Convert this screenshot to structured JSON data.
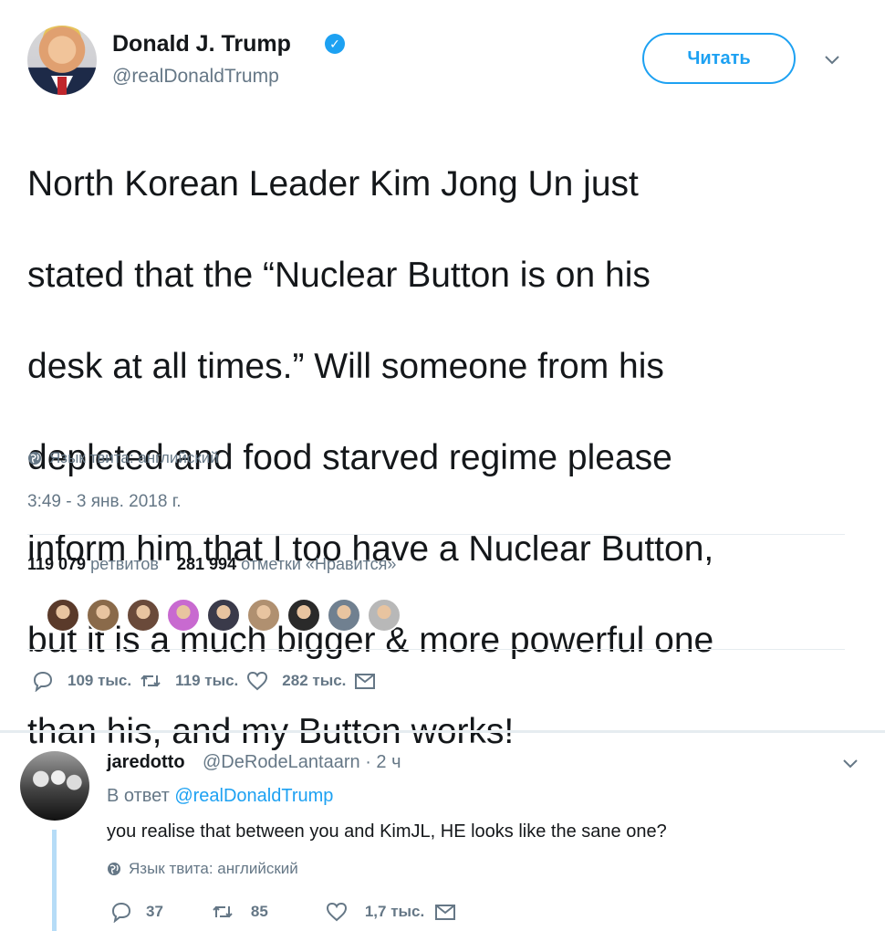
{
  "tweet": {
    "author_name": "Donald J. Trump",
    "verified_glyph": "✓",
    "handle": "@realDonaldTrump",
    "follow_label": "Читать",
    "text_lines": [
      "North Korean Leader Kim Jong Un just",
      "stated that the “Nuclear Button is on his",
      "desk at all times.” Will someone from his",
      "depleted and food starved regime please",
      "inform him that I too have a Nuclear Button,",
      "but it is a much bigger & more powerful one",
      "than his, and my Button works!"
    ],
    "language_note": "Язык твита: английский",
    "timestamp": "3:49 - 3 янв. 2018 г.",
    "retweets_count": "119 079",
    "retweets_label": "ретвитов",
    "likes_count": "281 994",
    "likes_label": "отметки «Нравится»",
    "liker_colors": [
      "#5a3a2a",
      "#8a6a4a",
      "#6a4a3a",
      "#c86ad0",
      "#3a3a4a",
      "#b09070",
      "#2a2a2a",
      "#708090",
      "#b8b8b8"
    ],
    "actions": {
      "replies": "109 тыс.",
      "retweets": "119 тыс.",
      "likes": "282 тыс."
    }
  },
  "reply": {
    "author_name": "jaredotto",
    "handle_time": "@DeRodeLantaarn · 2 ч",
    "in_reply_prefix": "В ответ",
    "in_reply_mention": "@realDonaldTrump",
    "text": "you realise that between you and KimJL, HE looks like the sane one?",
    "language_note": "Язык твита: английский",
    "actions": {
      "replies": "37",
      "retweets": "85",
      "likes": "1,7 тыс."
    }
  },
  "colors": {
    "accent": "#1da1f2",
    "muted": "#657786",
    "text": "#14171a",
    "divider": "#e6ecf0",
    "thread": "#b6dcf7"
  },
  "icons": [
    "verified-badge-icon",
    "chevron-down-icon",
    "globe-icon",
    "reply-icon",
    "retweet-icon",
    "like-icon",
    "direct-message-icon"
  ]
}
